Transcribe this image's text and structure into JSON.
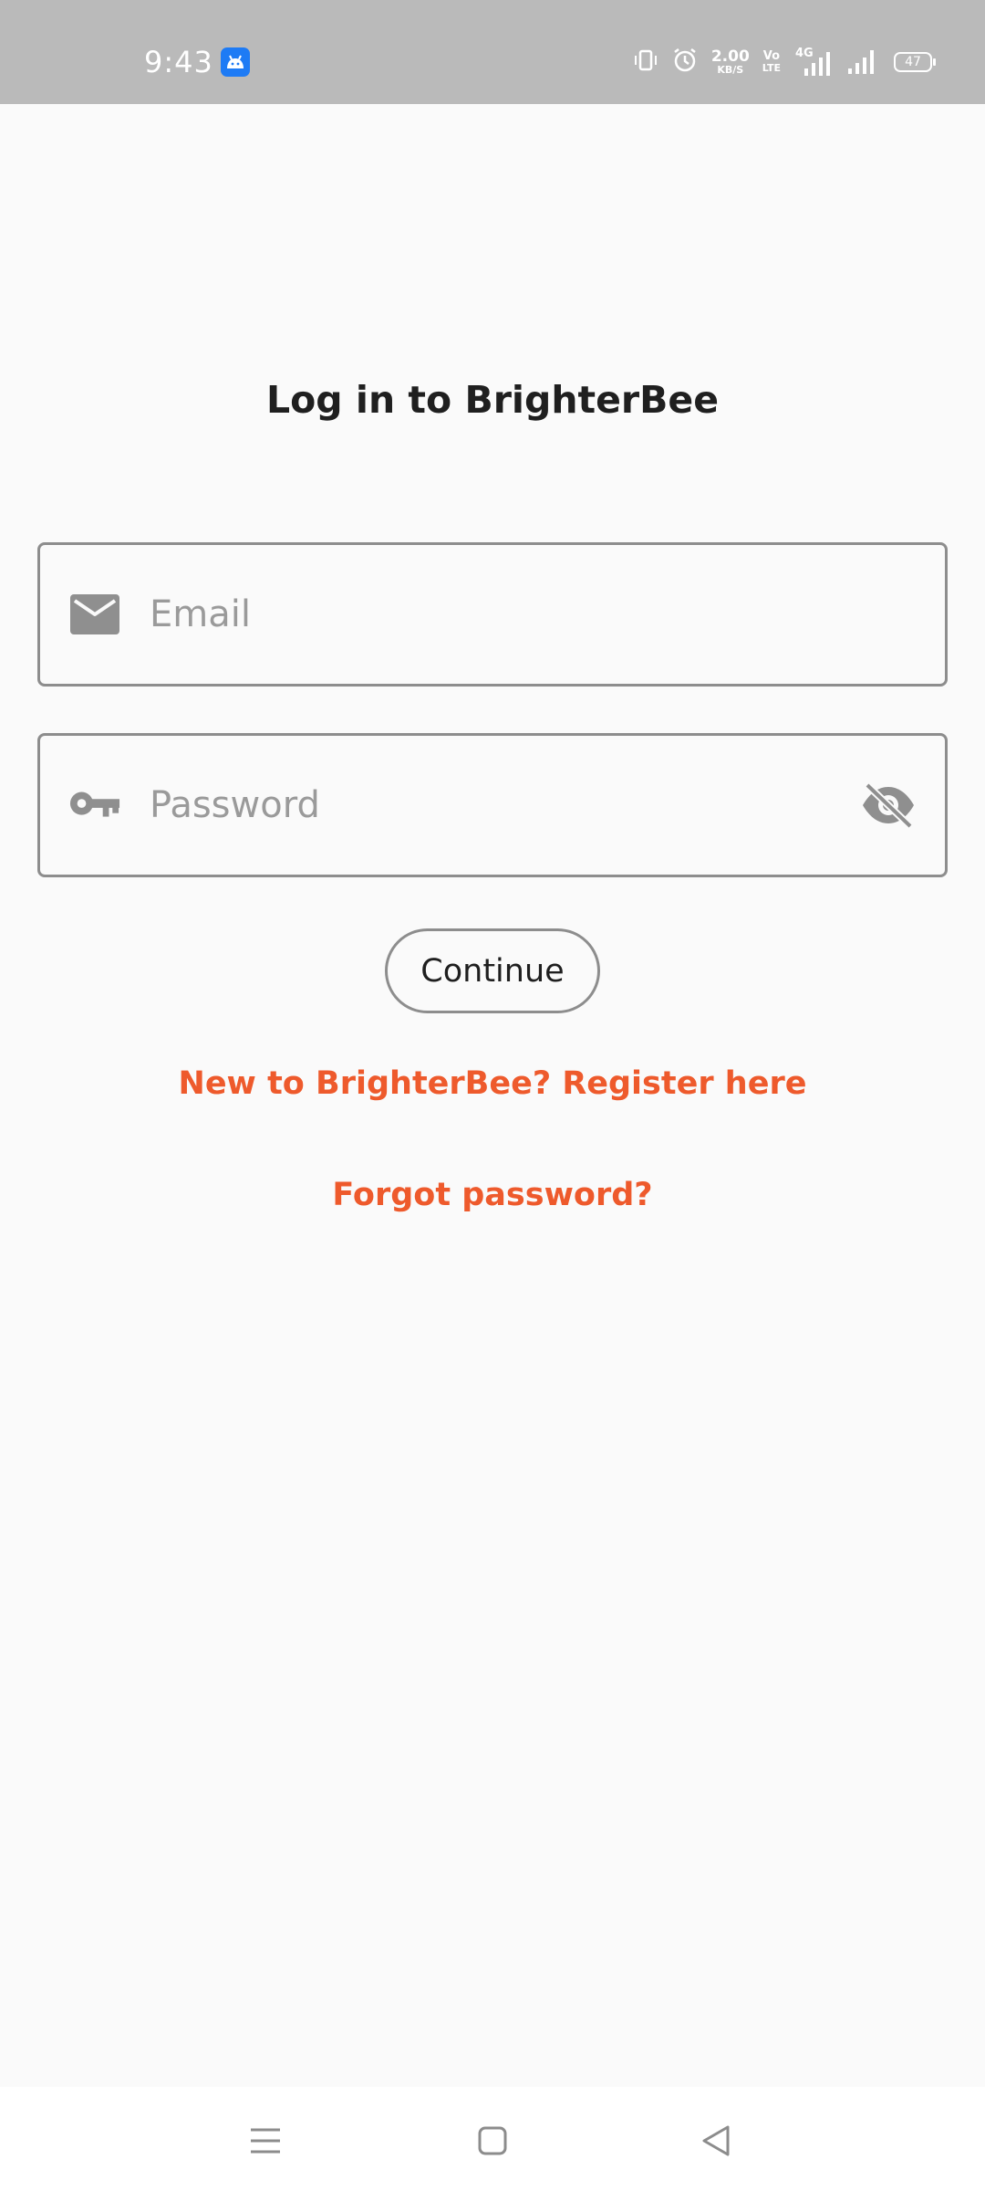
{
  "status_bar": {
    "time": "9:43",
    "app_icon": "android-icon",
    "data_speed_value": "2.00",
    "data_speed_unit": "KB/S",
    "volte_top": "Vo",
    "volte_bottom": "LTE",
    "network_type": "4G",
    "battery_level": "47",
    "icons": [
      "vibrate-icon",
      "alarm-icon",
      "signal-icon"
    ]
  },
  "login": {
    "title": "Log in to BrighterBee",
    "email": {
      "placeholder": "Email",
      "value": "",
      "icon": "mail-icon"
    },
    "password": {
      "placeholder": "Password",
      "value": "",
      "icon": "key-icon",
      "toggle_icon": "visibility-off-icon"
    },
    "continue_label": "Continue",
    "register_link": "New to BrighterBee? Register here",
    "forgot_link": "Forgot password?"
  },
  "nav_bar": {
    "icons": [
      "menu-icon",
      "home-icon",
      "back-icon"
    ]
  },
  "colors": {
    "accent": "#ee5a2c",
    "status_bar_bg": "#bababa",
    "background": "#fafafa",
    "field_border": "#8d8d8d",
    "placeholder": "#9a9a9a",
    "icon_gray": "#8f8f8f"
  }
}
